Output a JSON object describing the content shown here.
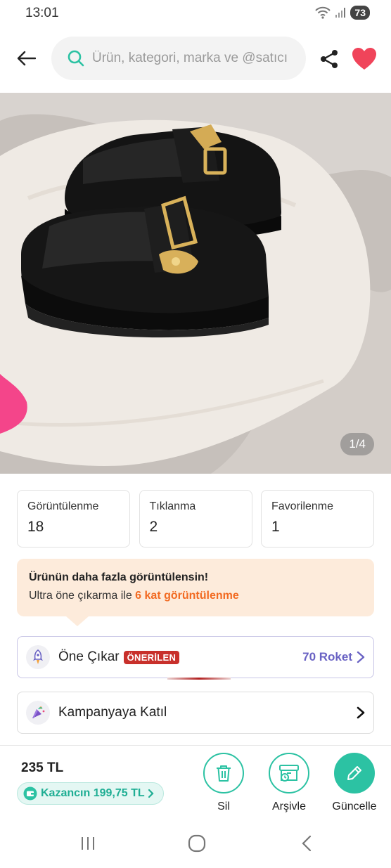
{
  "status_bar": {
    "time": "13:01",
    "battery": "73"
  },
  "search": {
    "placeholder": "Ürün, kategori, marka ve @satıcı"
  },
  "product_image": {
    "counter": "1/4"
  },
  "stats": [
    {
      "label": "Görüntülenme",
      "value": "18"
    },
    {
      "label": "Tıklanma",
      "value": "2"
    },
    {
      "label": "Favorilenme",
      "value": "1"
    }
  ],
  "promo": {
    "title": "Ürünün daha fazla görüntülensin!",
    "text_prefix": "Ultra öne çıkarma ile ",
    "text_highlight": "6 kat görüntülenme"
  },
  "boost_row": {
    "label": "Öne Çıkar",
    "badge": "ÖNERİLEN",
    "price": "70 Roket"
  },
  "campaign_row": {
    "label": "Kampanyaya Katıl"
  },
  "bottom": {
    "price": "235 TL",
    "earn": "Kazancın 199,75 TL",
    "actions": {
      "delete": "Sil",
      "archive": "Arşivle",
      "update": "Güncelle"
    }
  },
  "colors": {
    "accent": "#2cc2a3",
    "promo_bg": "#fdebdb",
    "highlight": "#f26a21",
    "badge": "#c8302b",
    "roket": "#6a63c4",
    "heart": "#f0445a"
  }
}
